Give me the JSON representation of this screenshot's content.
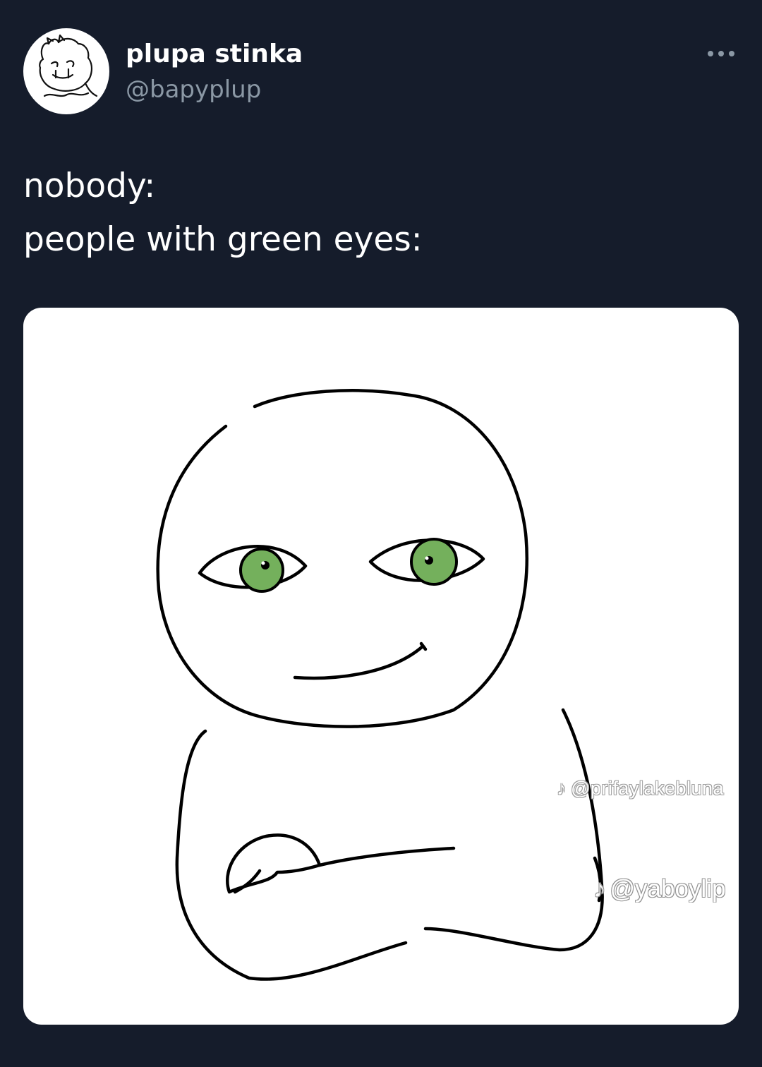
{
  "author": {
    "name": "plupa stinka",
    "handle": "@bapyplup"
  },
  "tweet": {
    "lines": [
      "nobody:",
      "people with green eyes:"
    ]
  },
  "media": {
    "watermarks": [
      "@prifaylakebluna",
      "@yaboylip"
    ]
  },
  "icons": {
    "more": "more-horizontal-icon",
    "watermark": "tiktok-icon"
  },
  "colors": {
    "background": "#151c2b",
    "handle": "#8b98a5",
    "eye_green": "#74b05c"
  }
}
